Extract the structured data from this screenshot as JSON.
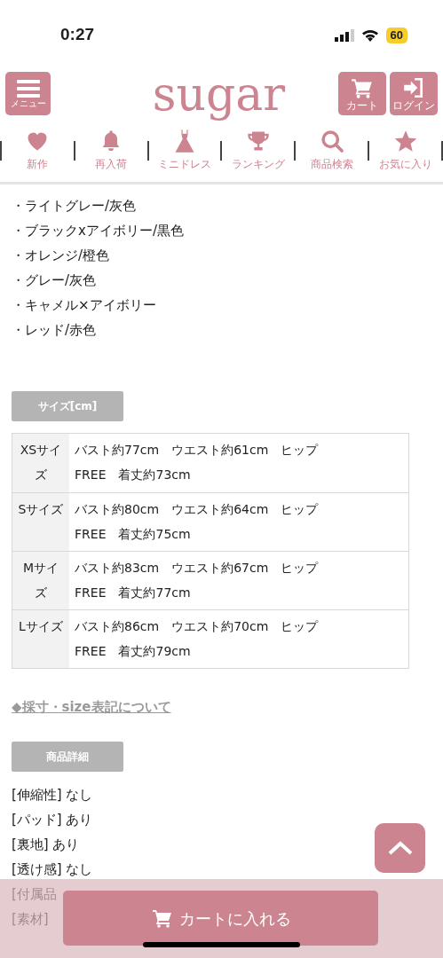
{
  "status_bar": {
    "time": "0:27",
    "battery": "60"
  },
  "header": {
    "logo": "sugar",
    "menu": {
      "label": "メニュー"
    },
    "actions": [
      {
        "kind": "cart",
        "label": "カート"
      },
      {
        "kind": "login",
        "label": "ログイン"
      }
    ]
  },
  "nav": [
    {
      "kind": "heart",
      "label": "新作"
    },
    {
      "kind": "bell",
      "label": "再入荷"
    },
    {
      "kind": "dress",
      "label": "ミニドレス"
    },
    {
      "kind": "trophy",
      "label": "ランキング"
    },
    {
      "kind": "search",
      "label": "商品検索"
    },
    {
      "kind": "star",
      "label": "お気に入り"
    }
  ],
  "colors": [
    "・ライトグレー/灰色",
    "・ブラックxアイボリー/黒色",
    "・オレンジ/橙色",
    "・グレー/灰色",
    "・キャメル×アイボリー",
    "・レッド/赤色"
  ],
  "size_heading": "サイズ[cm]",
  "size_table": [
    {
      "size": "XSサイズ",
      "line1": "バスト約77cm　ウエスト約61cm　ヒップ",
      "line2": "FREE　着丈約73cm"
    },
    {
      "size": "Sサイズ",
      "line1": "バスト約80cm　ウエスト約64cm　ヒップ",
      "line2": "FREE　着丈約75cm"
    },
    {
      "size": "Mサイズ",
      "line1": "バスト約83cm　ウエスト約67cm　ヒップ",
      "line2": "FREE　着丈約77cm"
    },
    {
      "size": "Lサイズ",
      "line1": "バスト約86cm　ウエスト約70cm　ヒップ",
      "line2": "FREE　着丈約79cm"
    }
  ],
  "size_link": "◆採寸・size表記について",
  "details_heading": "商品詳細",
  "details": [
    "[伸縮性] なし",
    "[パッド] あり",
    "[裏地] あり",
    "[透け感] なし",
    "[付属品",
    "[素材]"
  ],
  "cart_button": "カートに入れる"
}
